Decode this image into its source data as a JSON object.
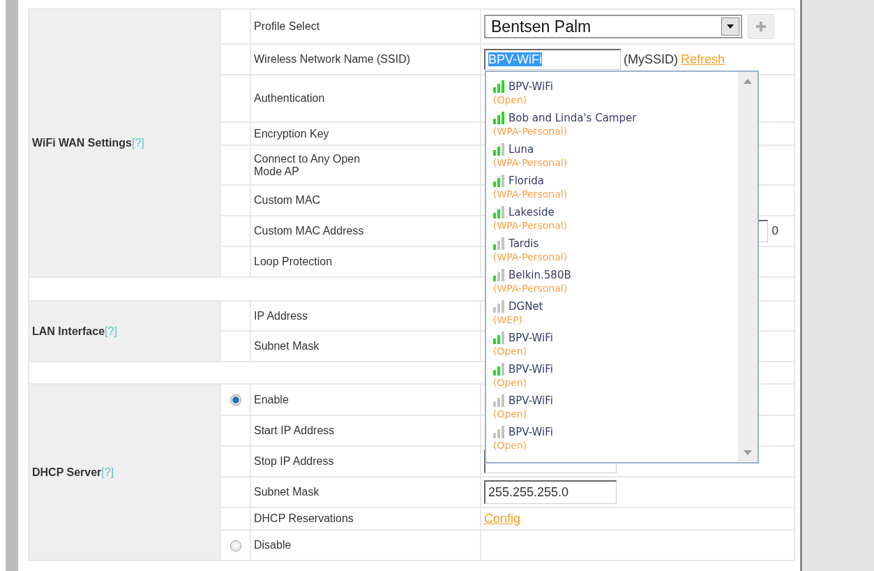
{
  "sections": [
    {
      "title": "WiFi WAN Settings",
      "help": "[?]",
      "rows": [
        {
          "label": "Profile Select",
          "kind": "profile",
          "value": "Bentsen Palm"
        },
        {
          "label": "Wireless Network Name (SSID)",
          "kind": "ssid",
          "value": "BPV-WiFi",
          "text_selected": true,
          "note": "(MySSID)",
          "link": "Refresh"
        },
        {
          "label": "Authentication",
          "kind": "covered"
        },
        {
          "label": "Encryption Key",
          "kind": "covered"
        },
        {
          "label": "Connect to Any Open Mode AP",
          "kind": "covered"
        },
        {
          "label": "Custom MAC",
          "kind": "covered"
        },
        {
          "label": "Custom MAC Address",
          "kind": "mac",
          "tail": "0"
        },
        {
          "label": "Loop Protection",
          "kind": "covered"
        }
      ]
    },
    {
      "title": "LAN Interface",
      "help": "[?]",
      "rows": [
        {
          "label": "IP Address",
          "kind": "covered"
        },
        {
          "label": "Subnet Mask",
          "kind": "covered"
        }
      ]
    },
    {
      "title": "DHCP Server",
      "help": "[?]",
      "rows": [
        {
          "label": "Enable",
          "kind": "covered",
          "radio": {
            "selected": true
          }
        },
        {
          "label": "Start IP Address",
          "kind": "covered"
        },
        {
          "label": "Stop IP Address",
          "kind": "field"
        },
        {
          "label": "Subnet Mask",
          "kind": "input",
          "value": "255.255.255.0"
        },
        {
          "label": "DHCP Reservations",
          "kind": "link",
          "link": "Config"
        },
        {
          "label": "Disable",
          "kind": "covered",
          "radio": {
            "selected": false
          }
        }
      ]
    }
  ],
  "network_list": [
    {
      "name": "BPV-WiFi",
      "security": "(Open)",
      "kind": "strong"
    },
    {
      "name": "Bob and Linda's Camper",
      "security": "(WPA-Personal)",
      "kind": "strong"
    },
    {
      "name": "Luna",
      "security": "(WPA-Personal)",
      "kind": "fair"
    },
    {
      "name": "Florida",
      "security": "(WPA-Personal)",
      "kind": "fair"
    },
    {
      "name": "Lakeside",
      "security": "(WPA-Personal)",
      "kind": "fair"
    },
    {
      "name": "Tardis",
      "security": "(WPA-Personal)",
      "kind": "weak"
    },
    {
      "name": "Belkin.580B",
      "security": "(WPA-Personal)",
      "kind": "weak"
    },
    {
      "name": "DGNet",
      "security": "(WEP)",
      "kind": "silent"
    },
    {
      "name": "BPV-WiFi",
      "security": "(Open)",
      "kind": "fair"
    },
    {
      "name": "BPV-WiFi",
      "security": "(Open)",
      "kind": "fair"
    },
    {
      "name": "BPV-WiFi",
      "security": "(Open)",
      "kind": "silent"
    },
    {
      "name": "BPV-WiFi",
      "security": "(Open)",
      "kind": "silent"
    }
  ]
}
